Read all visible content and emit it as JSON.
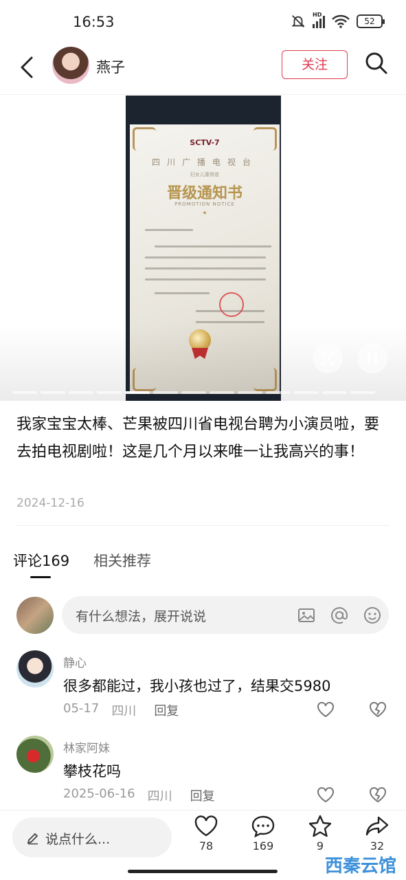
{
  "status_bar": {
    "time": "16:53",
    "network": "HD",
    "battery": "52"
  },
  "header": {
    "username": "燕子",
    "follow_label": "关注"
  },
  "certificate": {
    "logo": "SCTV-7",
    "org": "四川广播电视台",
    "sub": "妇女儿童频道",
    "title": "晋级通知书",
    "title_en": "PROMOTION NOTICE"
  },
  "post": {
    "text": "我家宝宝太棒、芒果被四川省电视台聘为小演员啦，要去拍电视剧啦！这是几个月以来唯一让我高兴的事！",
    "date": "2024-12-16"
  },
  "tabs": [
    {
      "label": "评论169"
    },
    {
      "label": "相关推荐"
    }
  ],
  "comment_input": {
    "placeholder": "有什么想法，展开说说"
  },
  "comments": [
    {
      "name": "静心",
      "text": "很多都能过，我小孩也过了，结果交5980",
      "date": "05-17",
      "location": "四川",
      "reply": "回复"
    },
    {
      "name": "林家阿妹",
      "text": "攀枝花吗",
      "date": "2025-06-16",
      "location": "四川",
      "reply": "回复"
    }
  ],
  "bottom_bar": {
    "say_placeholder": "说点什么...",
    "likes": "78",
    "comments": "169",
    "favorites": "9",
    "shares": "32",
    "watermark": "西秦云馆"
  },
  "colors": {
    "accent": "#e0394f",
    "watermark": "#2a86d6"
  }
}
